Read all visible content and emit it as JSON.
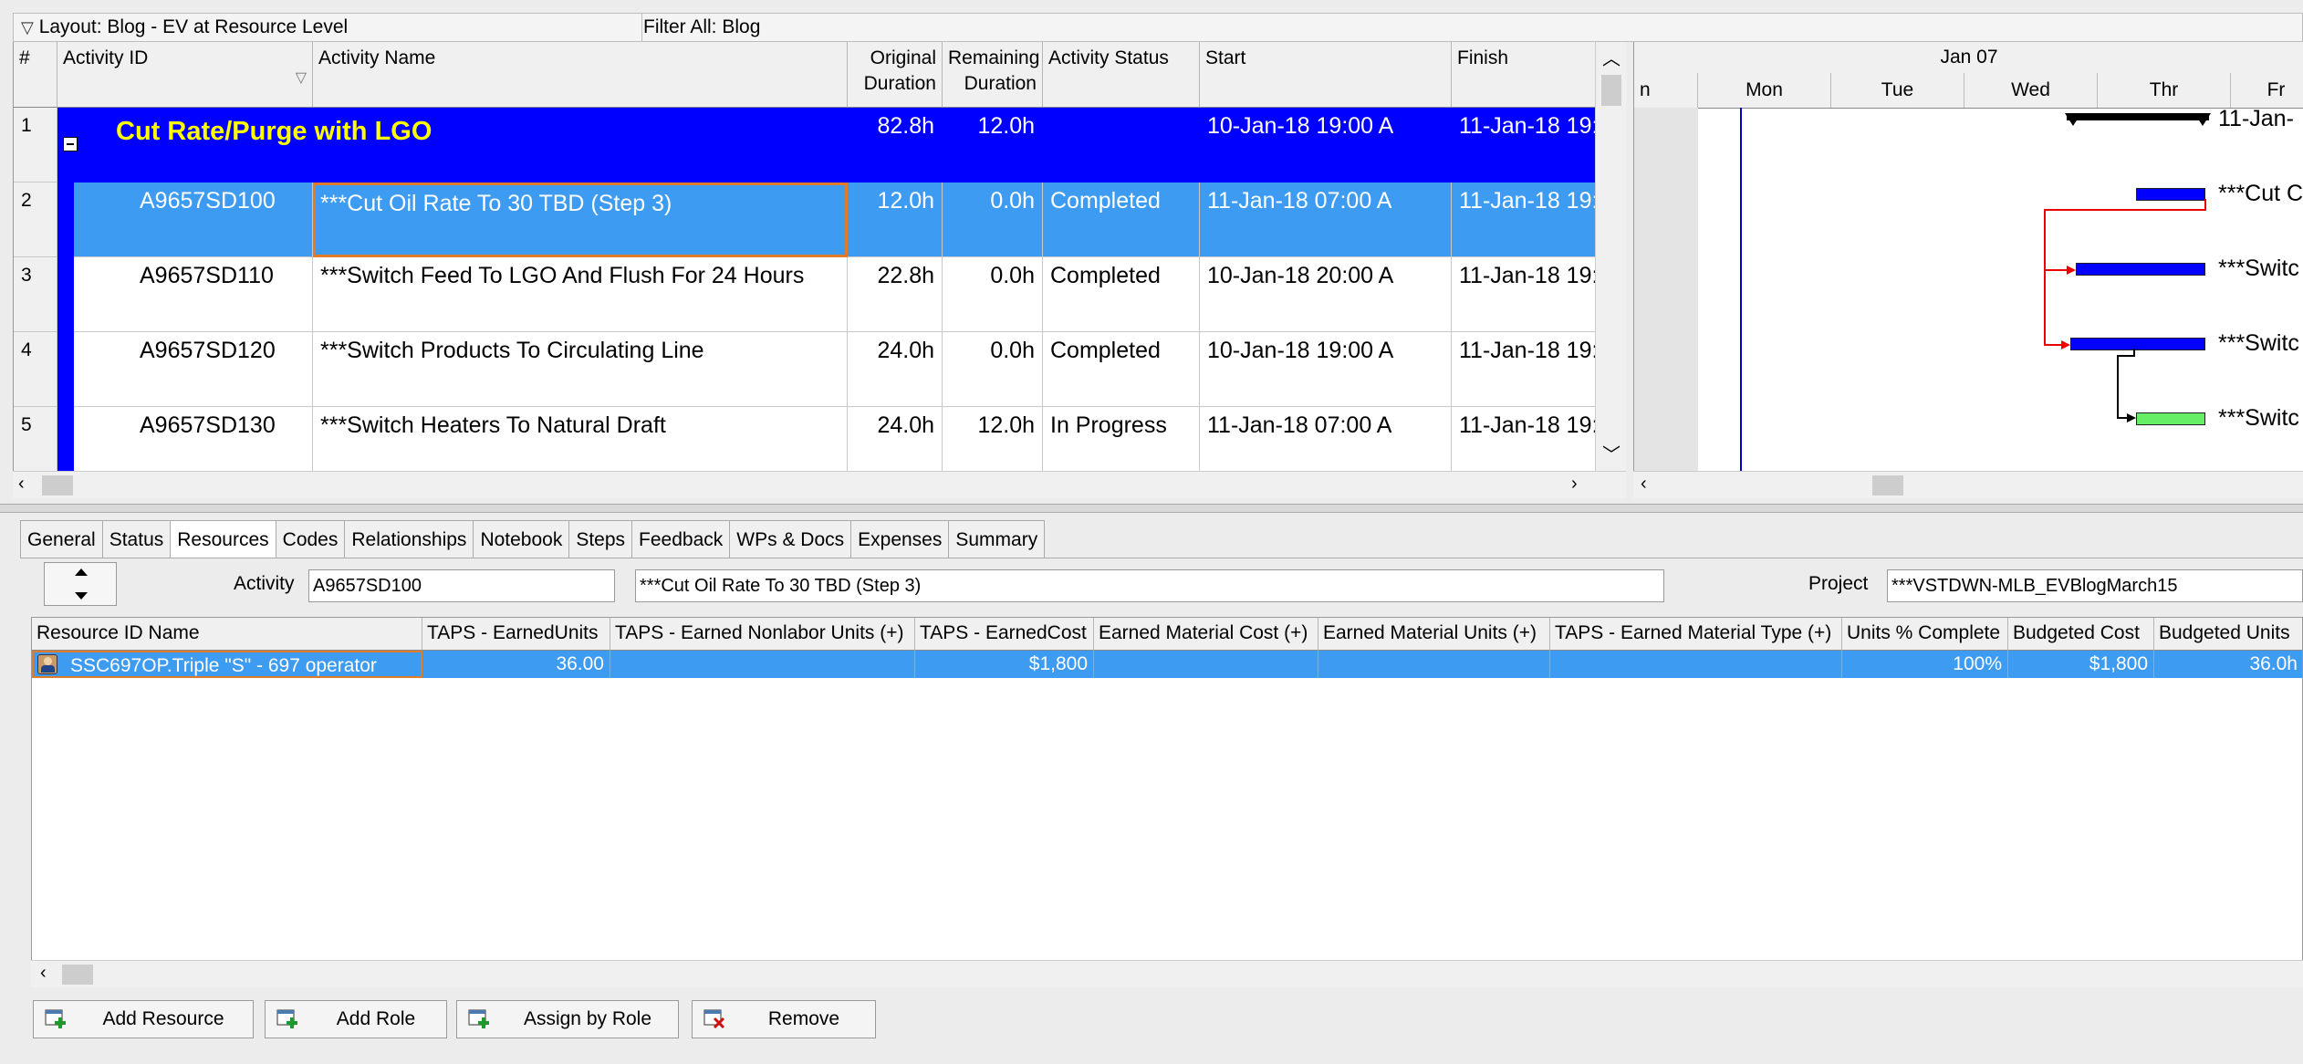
{
  "layout_bar": {
    "layout": "Layout: Blog - EV at Resource Level",
    "filter": "Filter All: Blog"
  },
  "grid": {
    "columns": {
      "num": "#",
      "activity_id": "Activity ID",
      "activity_name": "Activity Name",
      "orig_dur_1": "Original",
      "orig_dur_2": "Duration",
      "rem_dur_1": "Remaining",
      "rem_dur_2": "Duration",
      "status": "Activity Status",
      "start": "Start",
      "finish": "Finish"
    },
    "rows": [
      {
        "num": "1",
        "id": "",
        "name": "Cut Rate/Purge with LGO",
        "orig": "82.8h",
        "rem": "12.0h",
        "status": "",
        "start": "10-Jan-18 19:00 A",
        "finish": "11-Jan-18 19:0"
      },
      {
        "num": "2",
        "id": "A9657SD100",
        "name": "***Cut Oil Rate To 30 TBD (Step 3)",
        "orig": "12.0h",
        "rem": "0.0h",
        "status": "Completed",
        "start": "11-Jan-18 07:00 A",
        "finish": "11-Jan-18 19:0"
      },
      {
        "num": "3",
        "id": "A9657SD110",
        "name": "***Switch Feed To LGO And Flush For 24 Hours",
        "orig": "22.8h",
        "rem": "0.0h",
        "status": "Completed",
        "start": "10-Jan-18 20:00 A",
        "finish": "11-Jan-18 19:0"
      },
      {
        "num": "4",
        "id": "A9657SD120",
        "name": "***Switch Products To Circulating Line",
        "orig": "24.0h",
        "rem": "0.0h",
        "status": "Completed",
        "start": "10-Jan-18 19:00 A",
        "finish": "11-Jan-18 19:0"
      },
      {
        "num": "5",
        "id": "A9657SD130",
        "name": "***Switch Heaters To Natural Draft",
        "orig": "24.0h",
        "rem": "12.0h",
        "status": "In Progress",
        "start": "11-Jan-18 07:00 A",
        "finish": "11-Jan-18 19:0"
      }
    ]
  },
  "gantt": {
    "week": "Jan 07",
    "days": [
      "n",
      "Mon",
      "Tue",
      "Wed",
      "Thr",
      "Fr"
    ],
    "labels": [
      "11-Jan-",
      "***Cut C",
      "***Switc",
      "***Switc",
      "***Switc"
    ]
  },
  "tabs": [
    "General",
    "Status",
    "Resources",
    "Codes",
    "Relationships",
    "Notebook",
    "Steps",
    "Feedback",
    "WPs & Docs",
    "Expenses",
    "Summary"
  ],
  "active_tab": "Resources",
  "detail": {
    "activity_label": "Activity",
    "activity_id": "A9657SD100",
    "activity_name": "***Cut Oil Rate To 30 TBD (Step 3)",
    "project_label": "Project",
    "project": "***VSTDWN-MLB_EVBlogMarch15"
  },
  "resources": {
    "columns": [
      "Resource ID Name",
      "TAPS - EarnedUnits",
      "TAPS - Earned Nonlabor Units (+)",
      "TAPS - EarnedCost",
      "Earned Material Cost (+)",
      "Earned Material Units (+)",
      "TAPS - Earned Material Type (+)",
      "Units % Complete",
      "Budgeted Cost",
      "Budgeted Units"
    ],
    "row": {
      "name": "SSC697OP.Triple \"S\" - 697 operator",
      "earned_units": "36.00",
      "nonlabor": "",
      "earned_cost": "$1,800",
      "mat_cost": "",
      "mat_units": "",
      "mat_type": "",
      "pct": "100%",
      "budget_cost": "$1,800",
      "budget_units": "36.0h"
    }
  },
  "buttons": {
    "add_resource": "Add Resource",
    "add_role": "Add Role",
    "assign_by_role": "Assign by Role",
    "remove": "Remove"
  },
  "colors": {
    "wbs_band": "#0000ff",
    "wbs_text": "#ffff00",
    "selection": "#3d9cf2",
    "completed_bar": "#0000ff",
    "remaining_bar": "#66ee66",
    "relationship": "#ee0000"
  }
}
